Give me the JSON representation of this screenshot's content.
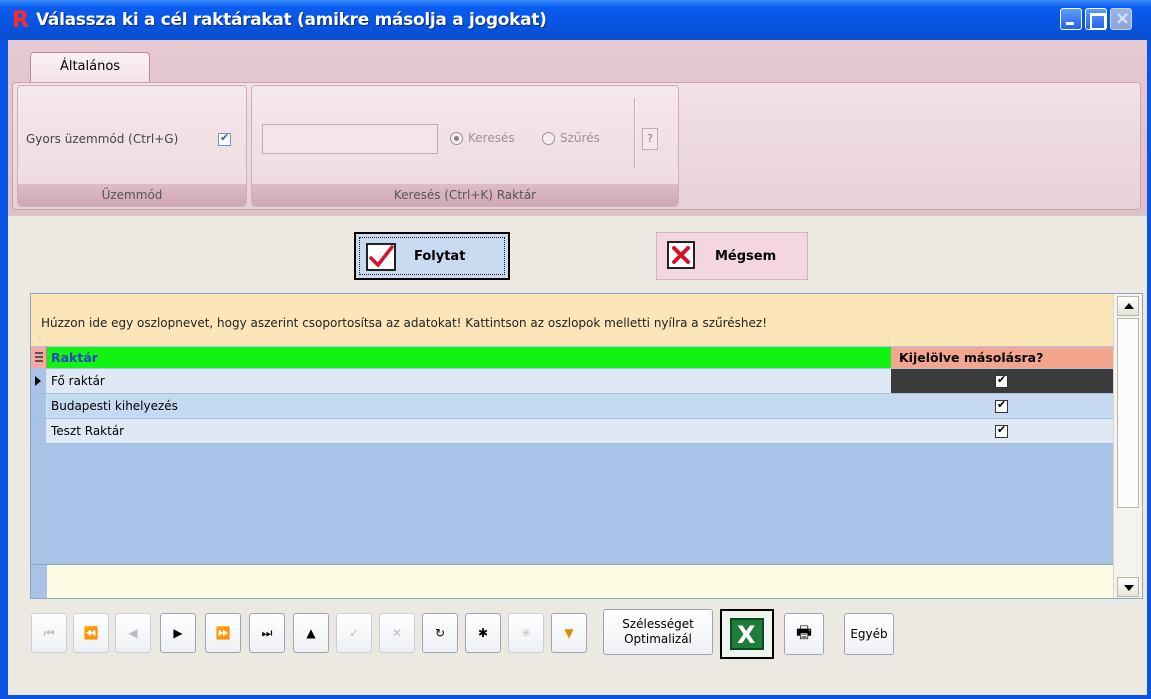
{
  "window": {
    "title": "Válassza ki a cél raktárakat (amikre másolja a jogokat)",
    "app_icon_letter": "R"
  },
  "ribbon": {
    "tab_label": "Általános",
    "groups": {
      "mode": {
        "label": "Üzemmód",
        "quick_mode_label": "Gyors üzemmód (Ctrl+G)",
        "quick_mode_checked": true
      },
      "search": {
        "label": "Keresés (Ctrl+K) Raktár",
        "search_value": "",
        "option_search": "Keresés",
        "option_filter": "Szűrés",
        "selected_option": "Keresés",
        "help_label": "?"
      }
    }
  },
  "actions": {
    "continue_label": "Folytat",
    "cancel_label": "Mégsem"
  },
  "grid": {
    "group_hint": "Húzzon ide egy oszlopnevet, hogy aszerint csoportosítsa az adatokat! Kattintson az oszlopok melletti nyílra a szűréshez!",
    "columns": [
      "Raktár",
      "Kijelölve másolásra?"
    ],
    "rows": [
      {
        "name": "Fő raktár",
        "selected": true
      },
      {
        "name": "Budapesti kihelyezés",
        "selected": true
      },
      {
        "name": "Teszt Raktár",
        "selected": true
      }
    ],
    "current_row": 0
  },
  "navigator": {
    "first": "⏮",
    "prev_page": "⏪",
    "prev": "◀",
    "next": "▶",
    "next_page": "⏩",
    "last": "⏭",
    "insert": "▲",
    "post": "✓",
    "cancel": "✕",
    "refresh": "↻",
    "new": "✱",
    "new_copy": "✳",
    "filter": "▼",
    "optimize_width_line1": "Szélességet",
    "optimize_width_line2": "Optimalizál",
    "excel_letter": "X",
    "print": "🖶",
    "other_label": "Egyéb"
  },
  "colors": {
    "title_bar": "#0754e0",
    "ribbon": "#e6c8d0",
    "header_raktar": "#11f311",
    "header_selected": "#f4a58e",
    "grid_background": "#a8c4e6",
    "group_panel": "#fce6b9"
  }
}
